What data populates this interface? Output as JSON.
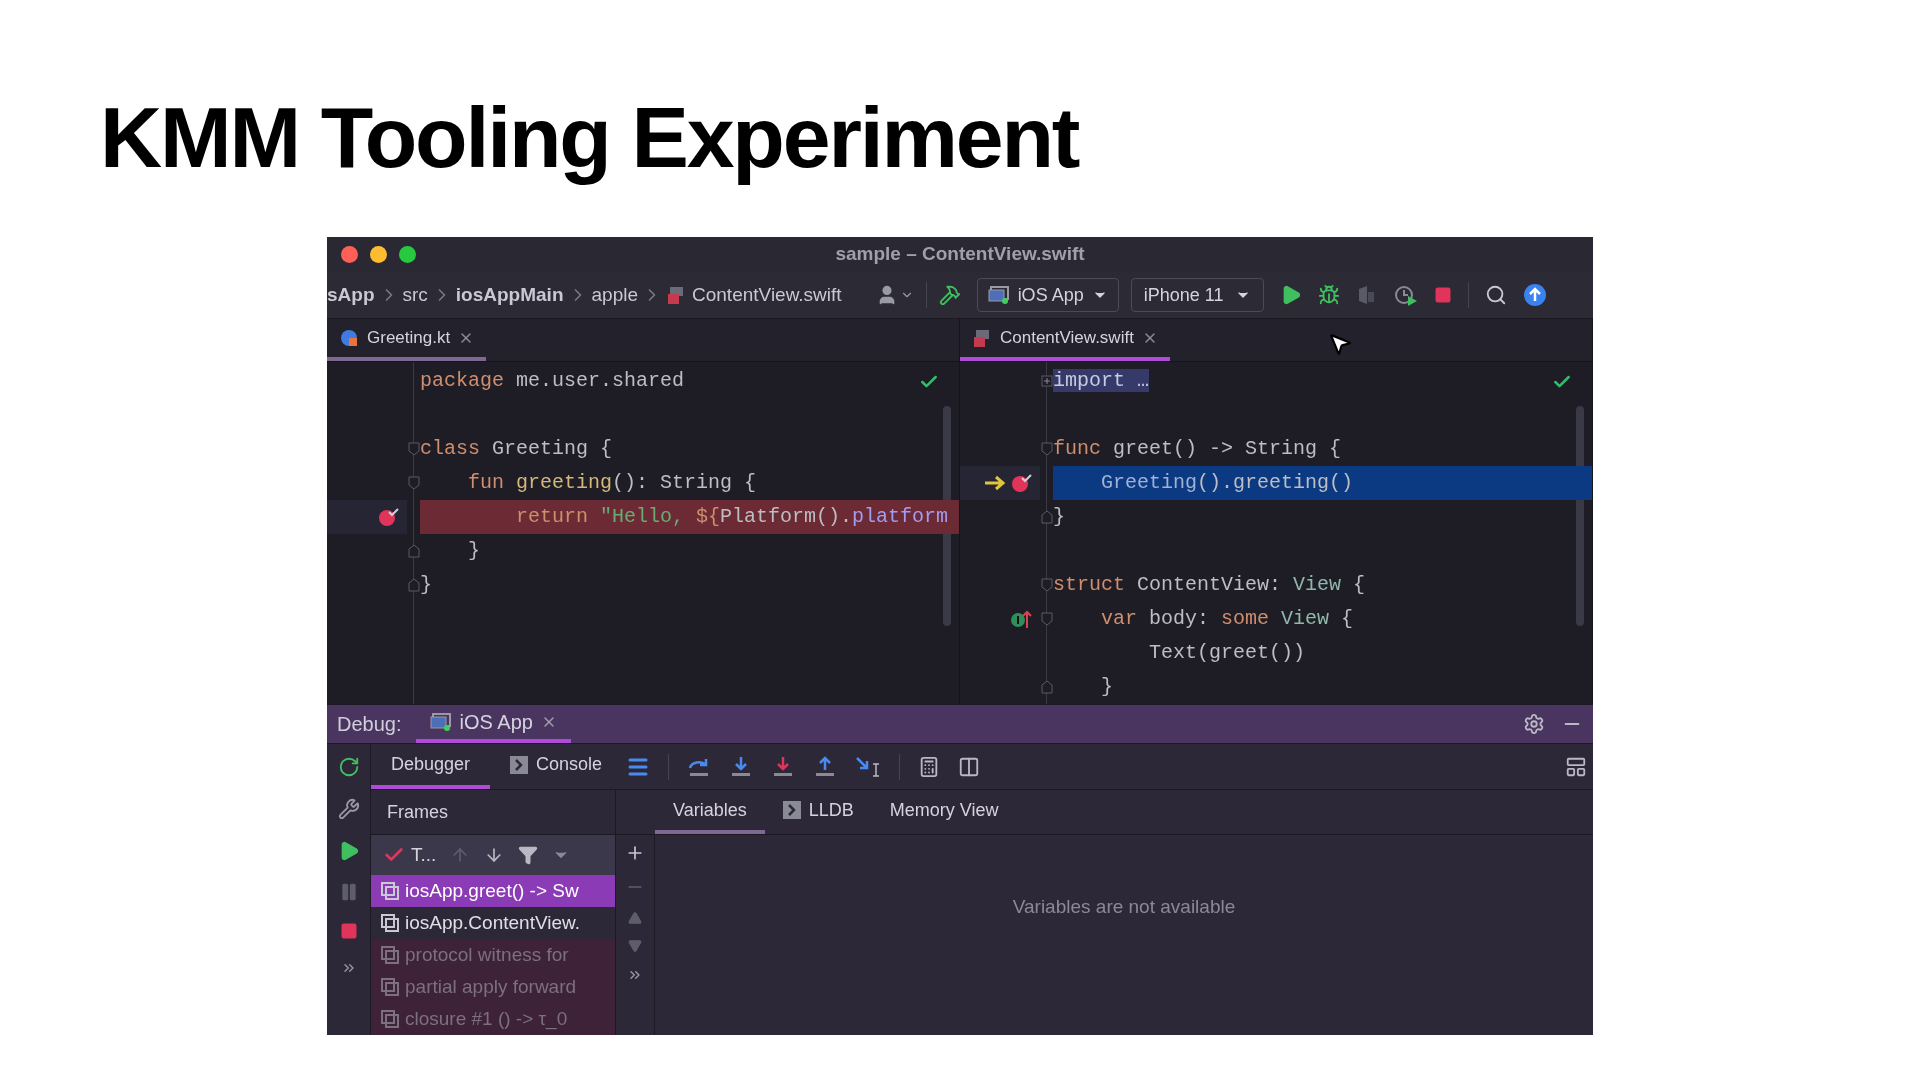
{
  "slide": {
    "title": "KMM Tooling Experiment"
  },
  "window": {
    "title": "sample – ContentView.swift"
  },
  "toolbar": {
    "breadcrumbs": [
      {
        "label": "sApp",
        "bold": true,
        "kind": "folder"
      },
      {
        "label": "src",
        "bold": false,
        "kind": "folder"
      },
      {
        "label": "iosAppMain",
        "bold": true,
        "kind": "folder"
      },
      {
        "label": "apple",
        "bold": false,
        "kind": "folder"
      },
      {
        "label": "ContentView.swift",
        "bold": false,
        "kind": "file"
      }
    ],
    "run_config": "iOS App",
    "device": "iPhone 11"
  },
  "editors": [
    {
      "tab": {
        "label": "Greeting.kt",
        "kind": "kotlin"
      },
      "focused": false,
      "lines": [
        {
          "tokens": [
            {
              "text": "package",
              "kind": "keyword"
            },
            {
              "text": " me.user.shared",
              "kind": "plain"
            }
          ],
          "kind": "plain",
          "breakpoint": false,
          "current": false,
          "override": false
        },
        {
          "kind": "plain",
          "breakpoint": false,
          "current": false,
          "override": false
        },
        {
          "tokens": [
            {
              "text": "class",
              "kind": "keyword"
            },
            {
              "text": " Greeting {",
              "kind": "plain"
            }
          ],
          "kind": "start",
          "breakpoint": false,
          "current": false,
          "override": false
        },
        {
          "tokens": [
            {
              "text": "    fun",
              "kind": "keyword"
            },
            {
              "text": " greeting",
              "kind": "function"
            },
            {
              "text": "(): String {",
              "kind": "plain"
            }
          ],
          "kind": "start",
          "breakpoint": false,
          "current": false,
          "override": false
        },
        {
          "tokens": [
            {
              "text": "        return",
              "kind": "keyword"
            },
            {
              "text": " \"Hello, ",
              "kind": "string"
            },
            {
              "text": "${",
              "kind": "keyword"
            },
            {
              "text": "Platform().",
              "kind": "plain"
            },
            {
              "text": "platform",
              "kind": "property"
            }
          ],
          "kind": "plain",
          "breakpoint": true,
          "current": false,
          "override": false
        },
        {
          "tokens": [
            {
              "text": "    }",
              "kind": "plain"
            }
          ],
          "kind": "end",
          "breakpoint": false,
          "current": false,
          "override": false
        },
        {
          "tokens": [
            {
              "text": "}",
              "kind": "plain"
            }
          ],
          "kind": "end",
          "breakpoint": false,
          "current": false,
          "override": false
        }
      ]
    },
    {
      "tab": {
        "label": "ContentView.swift",
        "kind": "swift"
      },
      "focused": true,
      "lines": [
        {
          "tokens": [
            {
              "text": "import …",
              "kind": "folded"
            }
          ],
          "kind": "collapsed",
          "breakpoint": false,
          "current": false,
          "override": false
        },
        {
          "kind": "plain",
          "breakpoint": false,
          "current": false,
          "override": false
        },
        {
          "tokens": [
            {
              "text": "func",
              "kind": "keyword"
            },
            {
              "text": " greet() -> String {",
              "kind": "plain"
            }
          ],
          "kind": "start",
          "breakpoint": false,
          "current": false,
          "override": false
        },
        {
          "tokens": [
            {
              "text": "    Greeting",
              "kind": "type"
            },
            {
              "text": "().greeting()",
              "kind": "plain"
            }
          ],
          "kind": "plain",
          "breakpoint": true,
          "current": true,
          "override": false
        },
        {
          "tokens": [
            {
              "text": "}",
              "kind": "plain"
            }
          ],
          "kind": "end",
          "breakpoint": false,
          "current": false,
          "override": false
        },
        {
          "kind": "plain",
          "breakpoint": false,
          "current": false,
          "override": false
        },
        {
          "tokens": [
            {
              "text": "struct",
              "kind": "keyword"
            },
            {
              "text": " ContentView: ",
              "kind": "plain"
            },
            {
              "text": "View",
              "kind": "protocol"
            },
            {
              "text": " {",
              "kind": "plain"
            }
          ],
          "kind": "start",
          "breakpoint": false,
          "current": false,
          "override": false
        },
        {
          "tokens": [
            {
              "text": "    var",
              "kind": "keyword"
            },
            {
              "text": " body: ",
              "kind": "plain"
            },
            {
              "text": "some",
              "kind": "keyword"
            },
            {
              "text": " View",
              "kind": "protocol"
            },
            {
              "text": " {",
              "kind": "plain"
            }
          ],
          "kind": "start",
          "breakpoint": false,
          "current": false,
          "override": true
        },
        {
          "tokens": [
            {
              "text": "        Text(greet())",
              "kind": "plain"
            }
          ],
          "kind": "plain",
          "breakpoint": false,
          "current": false,
          "override": false
        },
        {
          "tokens": [
            {
              "text": "    }",
              "kind": "plain"
            }
          ],
          "kind": "end",
          "breakpoint": false,
          "current": false,
          "override": false
        }
      ]
    }
  ],
  "debug": {
    "label": "Debug:",
    "tabs": [
      {
        "label": "iOS App",
        "selected": true
      }
    ],
    "view_tabs": [
      {
        "label": "Debugger",
        "selected": true,
        "kind": "plain"
      },
      {
        "label": "Console",
        "selected": false,
        "kind": "console"
      }
    ],
    "frames_title": "Frames",
    "thread": "T...",
    "frames": [
      {
        "label": "iosApp.greet() -> Sw",
        "selected": true,
        "library": false
      },
      {
        "label": "iosApp.ContentView.",
        "selected": false,
        "library": false
      },
      {
        "label": "protocol witness for",
        "selected": false,
        "library": true
      },
      {
        "label": "partial apply forward",
        "selected": false,
        "library": true
      },
      {
        "label": "closure #1 () -> τ_0",
        "selected": false,
        "library": true
      }
    ],
    "var_tabs": [
      {
        "label": "Variables",
        "selected": true,
        "kind": "plain"
      },
      {
        "label": "LLDB",
        "selected": false,
        "kind": "console"
      },
      {
        "label": "Memory View",
        "selected": false,
        "kind": "plain"
      }
    ],
    "empty_message": "Variables are not available"
  }
}
